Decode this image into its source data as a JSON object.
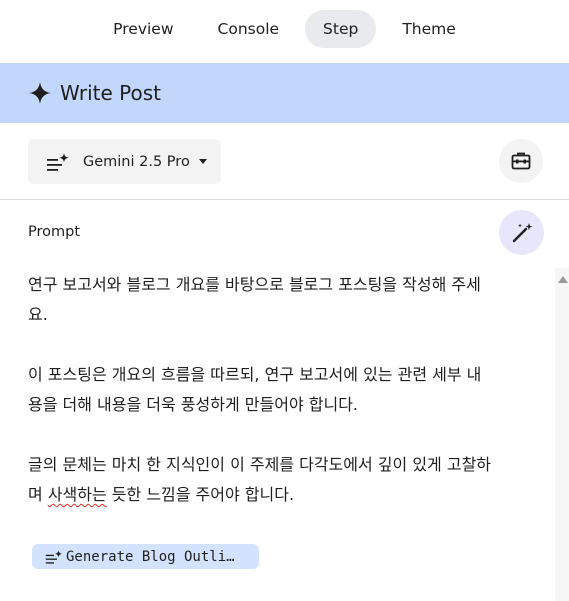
{
  "tabs": [
    {
      "label": "Preview",
      "active": false
    },
    {
      "label": "Console",
      "active": false
    },
    {
      "label": "Step",
      "active": true
    },
    {
      "label": "Theme",
      "active": false
    }
  ],
  "header": {
    "title": "Write Post",
    "icon": "sparkle-icon",
    "background": "#c2d7fb"
  },
  "model": {
    "label": "Gemini 2.5 Pro",
    "icon": "model-lines-sparkle-icon",
    "dropdown_icon": "caret-down-icon"
  },
  "toolbar": {
    "tool_icon": "toolbox-icon"
  },
  "prompt": {
    "label": "Prompt",
    "magic_icon": "magic-wand-icon",
    "line1": "연구 보고서와 블로그 개요를 바탕으로 블로그 포스팅을 작성해 주세",
    "line2": "요.",
    "line3": "이 포스팅은 개요의 흐름을 따르되, 연구 보고서에 있는 관련 세부 내",
    "line4": "용을 더해 내용을 더욱 풍성하게 만들어야 합니다.",
    "line5": "글의 문체는 마치 한 지식인이 이 주제를 다각도에서 깊이 있게 고찰하",
    "line6_start": "며 ",
    "line6_flagged": "사색하는",
    "line6_end": " 듯한 느낌을 주어야 합니다."
  },
  "chip": {
    "label": "Generate Blog Outli…",
    "icon": "model-lines-sparkle-icon",
    "background": "#d3e3fd"
  }
}
